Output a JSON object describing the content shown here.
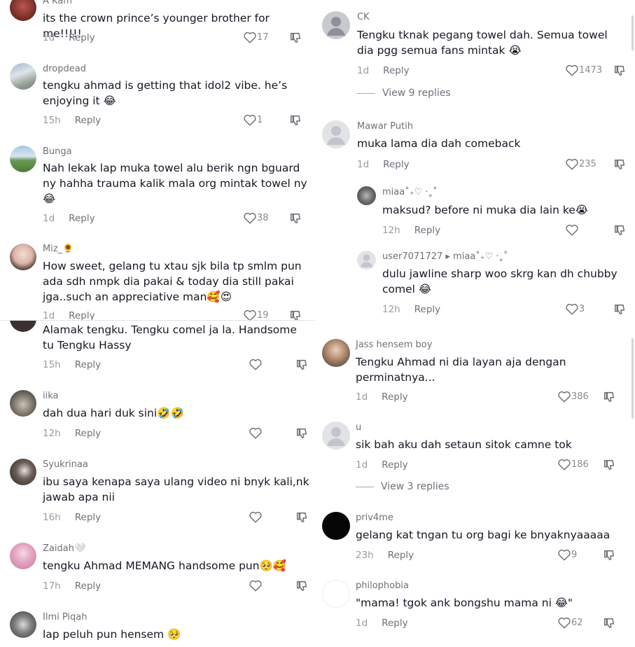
{
  "left": [
    {
      "user": "A Kam",
      "text": "its the crown prince’s younger brother for me!!!!!",
      "time": "1d",
      "reply": "Reply",
      "likes": "17"
    },
    {
      "user": "dropdead",
      "text": "tengku ahmad is getting that idol2 vibe. he’s enjoying it 😂",
      "time": "15h",
      "reply": "Reply",
      "likes": "1"
    },
    {
      "user": "Bunga",
      "text": "Nah lekak lap muka towel alu berik ngn bguard ny hahha trauma kalik mala org mintak towel ny 😂",
      "time": "1d",
      "reply": "Reply",
      "likes": "38"
    },
    {
      "user": "Miz_🌻",
      "text": "How sweet, gelang tu xtau sjk bila tp smlm pun ada sdh nmpk dia pakai & today dia still pakai jga..such an appreciative man🥰😍",
      "time": "1d",
      "reply": "Reply",
      "likes": "19"
    },
    {
      "user": "",
      "text": "Alamak tengku. Tengku comel ja la. Handsome tu Tengku Hassy",
      "time": "15h",
      "reply": "Reply",
      "likes": ""
    },
    {
      "user": "iika",
      "text": "dah dua hari duk sini🤣🤣",
      "time": "12h",
      "reply": "Reply",
      "likes": ""
    },
    {
      "user": "Syukrinaa",
      "text": "ibu saya kenapa saya ulang video ni bnyk kali,nk jawab apa nii",
      "time": "16h",
      "reply": "Reply",
      "likes": ""
    },
    {
      "user": "Zaidah🤍",
      "text": "tengku Ahmad MEMANG handsome pun🥺🥰",
      "time": "17h",
      "reply": "Reply",
      "likes": ""
    },
    {
      "user": "Ilmi Piqah",
      "text": "lap peluh pun hensem 🥺",
      "time": "",
      "reply": "",
      "likes": ""
    }
  ],
  "right": [
    {
      "user": "CK",
      "text": "Tengku tknak pegang towel dah. Semua towel dia pgg semua fans mintak 😭",
      "time": "1d",
      "reply": "Reply",
      "likes": "1473",
      "view_replies": "View 9 replies"
    },
    {
      "user": "Mawar Putih",
      "text": "muka lama dia dah comeback",
      "time": "1d",
      "reply": "Reply",
      "likes": "235"
    },
    {
      "user": "miaa˚₊♡ ·˳˚",
      "text": "maksud? before ni muka dia lain ke😭",
      "time": "12h",
      "reply": "Reply",
      "likes": ""
    },
    {
      "user": "user7071727 ▸ miaa˚₊♡ ·˳˚",
      "text": "dulu jawline sharp woo skrg kan dh chubby comel 😂",
      "time": "12h",
      "reply": "Reply",
      "likes": "3"
    },
    {
      "user": "Jass hensem boy",
      "text": "Tengku Ahmad ni dia layan aja dengan perminatnya...",
      "time": "1d",
      "reply": "Reply",
      "likes": "386"
    },
    {
      "user": "u",
      "text": "sik bah aku dah setaun sitok camne tok",
      "time": "1d",
      "reply": "Reply",
      "likes": "186",
      "view_replies": "View 3 replies"
    },
    {
      "user": "priv4me",
      "text": "gelang kat tngan tu org bagi ke bnyaknyaaaaa",
      "time": "23h",
      "reply": "Reply",
      "likes": "9"
    },
    {
      "user": "philophobia",
      "text": "\"mama! tgok ank bongshu mama ni 😂\"",
      "time": "1d",
      "reply": "Reply",
      "likes": "62"
    }
  ]
}
